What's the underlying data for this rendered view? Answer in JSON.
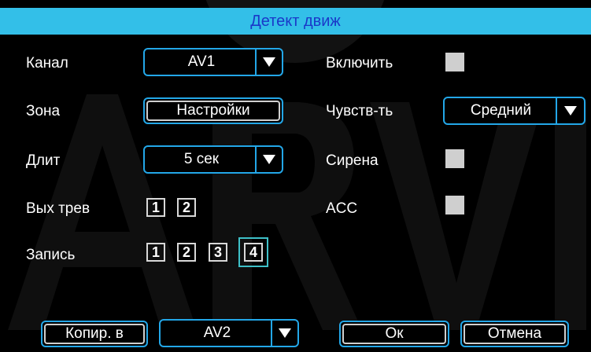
{
  "title": "Детект движ",
  "rows": {
    "channel": {
      "label": "Канал",
      "value": "AV1"
    },
    "enable": {
      "label": "Включить"
    },
    "zone": {
      "label": "Зона",
      "button": "Настройки"
    },
    "sensitivity": {
      "label": "Чувств-ть",
      "value": "Средний"
    },
    "duration": {
      "label": "Длит",
      "value": "5 сек"
    },
    "siren": {
      "label": "Сирена"
    },
    "alarm_out": {
      "label": "Вых трев",
      "boxes": [
        "1",
        "2"
      ]
    },
    "acc": {
      "label": "ACC"
    },
    "record": {
      "label": "Запись",
      "boxes": [
        "1",
        "2",
        "3",
        "4"
      ]
    }
  },
  "footer": {
    "copy_button": "Копир. в",
    "copy_target": "AV2",
    "ok_button": "Ок",
    "cancel_button": "Отмена"
  },
  "icons": {
    "dropdown": "triangle-down-icon"
  },
  "colors": {
    "title_bar": "#33bfe8",
    "title_text": "#1a39c9",
    "border": "#23a7e8",
    "checkbox": "#cfcfcf",
    "focus": "#3ec0c8"
  }
}
